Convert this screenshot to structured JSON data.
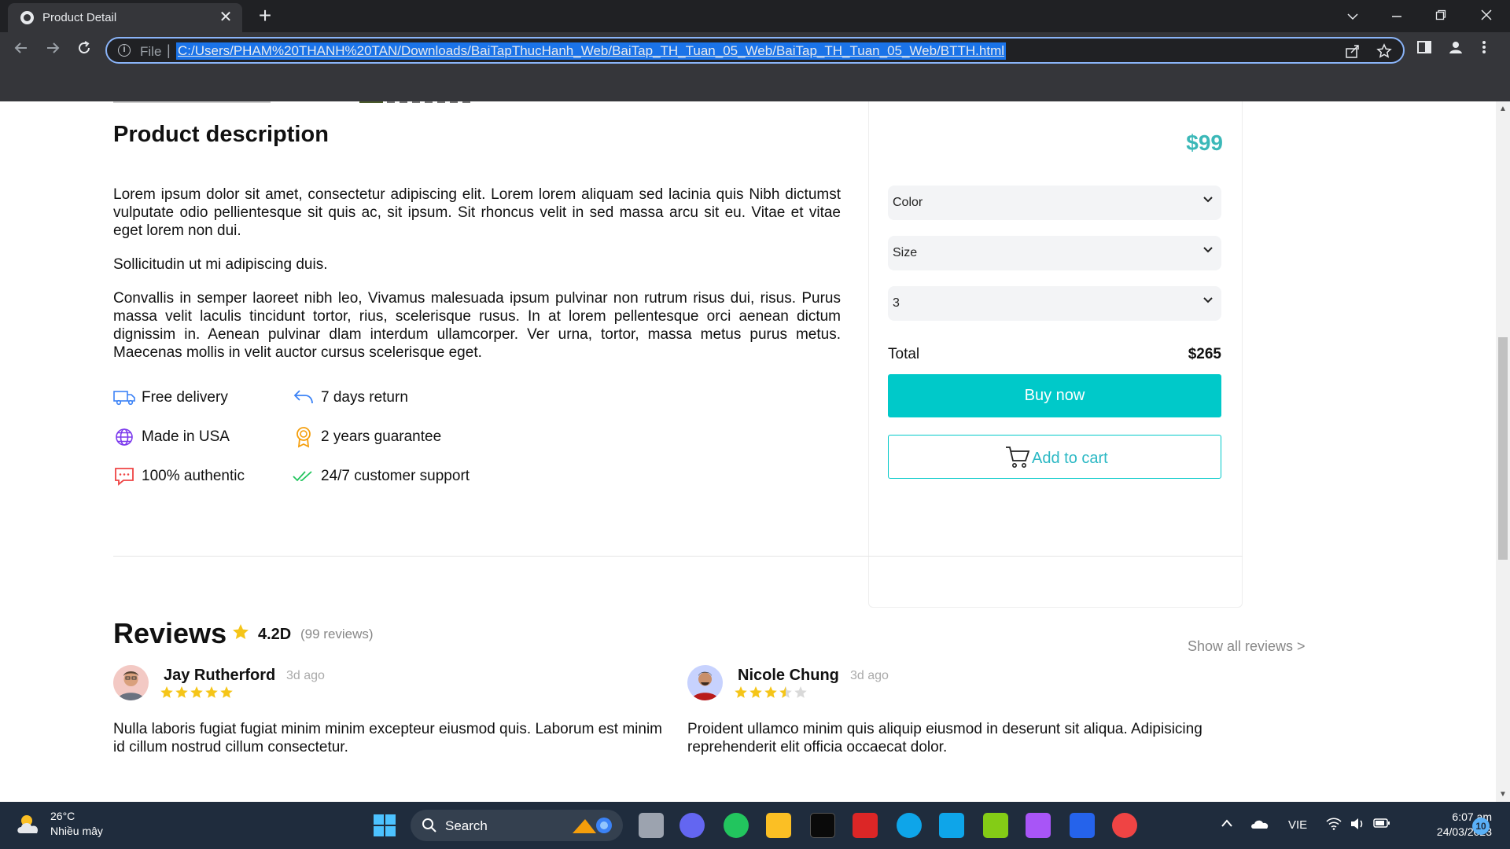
{
  "browser": {
    "tab_title": "Product Detail",
    "close_glyph": "✕",
    "new_tab_glyph": "+",
    "url_scheme": "File",
    "url_separator": "|",
    "url": "C:/Users/PHAM%20THANH%20TAN/Downloads/BaiTapThucHanh_Web/BaiTap_TH_Tuan_05_Web/BaiTap_TH_Tuan_05_Web/BTTH.html"
  },
  "product": {
    "description_title": "Product description",
    "paragraphs": [
      "Lorem ipsum dolor sit amet, consectetur adipiscing elit. Lorem lorem aliquam sed lacinia quis Nibh dictumst vulputate odio pellientesque sit quis ac, sit ipsum. Sit rhoncus velit in sed massa arcu sit eu. Vitae et vitae eget lorem non dui.",
      "Sollicitudin ut mi adipiscing duis.",
      "Convallis in semper laoreet nibh leo, Vivamus malesuada ipsum pulvinar non rutrum risus dui, risus. Purus massa velit laculis tincidunt tortor, rius, scelerisque rusus. In at lorem pellentesque orci aenean dictum dignissim in. Aenean pulvinar dlam interdum ullamcorper. Ver urna, tortor, massa metus purus metus. Maecenas mollis in velit auctor cursus scelerisque eget."
    ],
    "features": [
      {
        "icon": "truck-icon",
        "label": "Free delivery"
      },
      {
        "icon": "return-arrow-icon",
        "label": "7 days return"
      },
      {
        "icon": "globe-icon",
        "label": "Made in USA"
      },
      {
        "icon": "award-icon",
        "label": "2 years guarantee"
      },
      {
        "icon": "chat-icon",
        "label": "100% authentic"
      },
      {
        "icon": "double-check-icon",
        "label": "24/7 customer support"
      }
    ]
  },
  "purchase": {
    "price": "$99",
    "color_select": "Color",
    "size_select": "Size",
    "quantity_select": "3",
    "total_label": "Total",
    "total_value": "$265",
    "buy_label": "Buy now",
    "cart_label": "Add to cart",
    "accent": "#00c9c9",
    "price_color": "#3bb8b8"
  },
  "reviews": {
    "title": "Reviews",
    "rating": "4.2D",
    "count": "(99 reviews)",
    "show_all": "Show all reviews >",
    "items": [
      {
        "name": "Jay Rutherford",
        "time": "3d ago",
        "stars": 5,
        "text": "Nulla laboris fugiat fugiat minim minim excepteur eiusmod quis. Laborum est minim id cillum nostrud cillum consectetur."
      },
      {
        "name": "Nicole Chung",
        "time": "3d ago",
        "stars": 3.5,
        "text": "Proident ullamco minim quis aliquip eiusmod in deserunt sit aliqua. Adipisicing reprehenderit elit officia occaecat dolor."
      }
    ],
    "star_color": "#f5c518"
  },
  "taskbar": {
    "temperature": "26°C",
    "weather": "Nhiều mây",
    "search_label": "Search",
    "language": "VIE",
    "time": "6:07 am",
    "date": "24/03/2023",
    "notifications": "10"
  }
}
